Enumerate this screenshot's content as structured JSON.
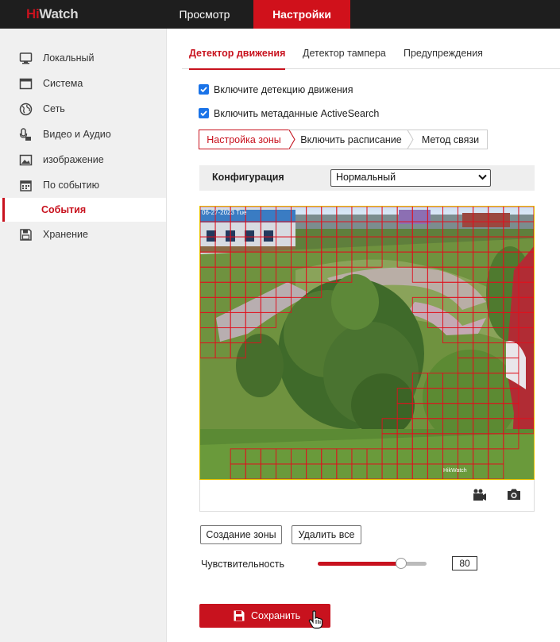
{
  "brand": {
    "hi": "Hi",
    "watch": "Watch"
  },
  "nav": {
    "preview": "Просмотр",
    "settings": "Настройки"
  },
  "sidebar": {
    "items": [
      {
        "label": "Локальный",
        "icon": "monitor-icon"
      },
      {
        "label": "Система",
        "icon": "window-icon"
      },
      {
        "label": "Сеть",
        "icon": "globe-icon"
      },
      {
        "label": "Видео и Аудио",
        "icon": "mic-camera-icon"
      },
      {
        "label": "изображение",
        "icon": "image-icon"
      },
      {
        "label": "По событию",
        "icon": "calendar-icon"
      },
      {
        "label": "Хранение",
        "icon": "floppy-icon"
      }
    ],
    "sub_item": "События"
  },
  "tabs": [
    "Детектор движения",
    "Детектор тампера",
    "Предупреждения"
  ],
  "checks": {
    "motion": "Включите детекцию движения",
    "metadata": "Включить метаданные ActiveSearch"
  },
  "steps": [
    "Настройка зоны",
    "Включить расписание",
    "Метод связи"
  ],
  "config": {
    "label": "Конфигурация",
    "value": "Нормальный"
  },
  "video": {
    "timestamp": "06-27-2023 Tue",
    "watermark": "HikWatch"
  },
  "buttons": {
    "create_zone": "Создание зоны",
    "delete_all": "Удалить все",
    "save": "Сохранить"
  },
  "sensitivity": {
    "label": "Чувствительность",
    "value": "80",
    "level": 80
  },
  "colors": {
    "accent": "#c8121e",
    "topbar": "#1e1e1e",
    "grid": "#e0101e"
  }
}
